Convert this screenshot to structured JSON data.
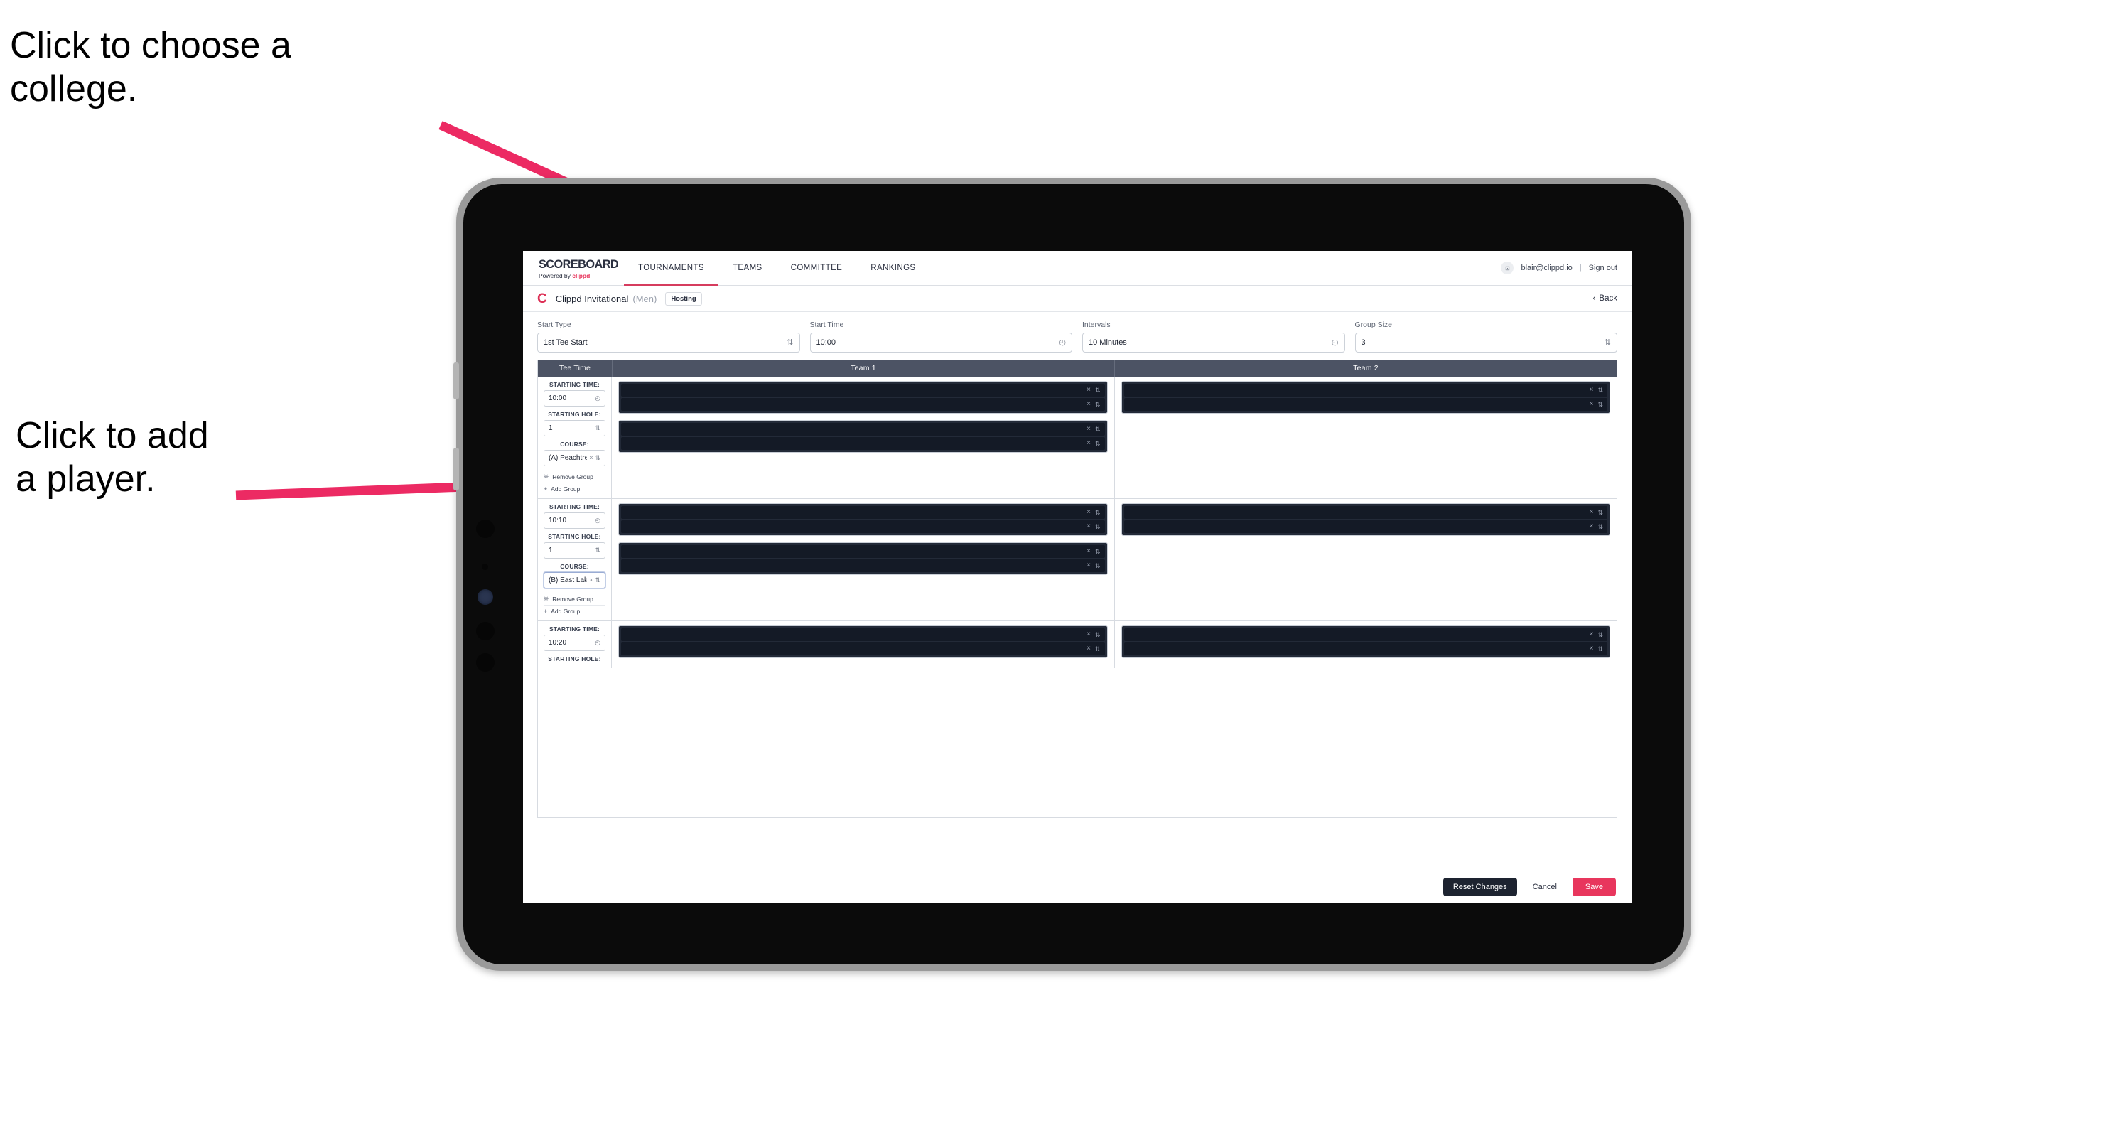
{
  "annotations": [
    {
      "id": "college",
      "text": "Click to choose a\ncollege."
    },
    {
      "id": "player",
      "text": "Click to add\na player."
    }
  ],
  "colors": {
    "accent_pink": "#e8365d",
    "arrow_pink": "#ec2a63",
    "nav_underline": "#d63c5e",
    "table_header": "#4c5364",
    "slot_dark": "#141a26",
    "slot_group": "#232a38",
    "tablet_frame": "#9a9a9a"
  },
  "app": {
    "topnav": {
      "brand_title": "SCOREBOARD",
      "brand_sub_prefix": "Powered by ",
      "brand_sub_accent": "clippd",
      "tabs": [
        {
          "label": "TOURNAMENTS",
          "active": true
        },
        {
          "label": "TEAMS",
          "active": false
        },
        {
          "label": "COMMITTEE",
          "active": false
        },
        {
          "label": "RANKINGS",
          "active": false
        }
      ],
      "avatar_glyph": "⊡",
      "user_email": "blair@clippd.io",
      "separator": "|",
      "sign_out": "Sign out"
    },
    "breadcrumb": {
      "logo": "C",
      "title": "Clippd Invitational",
      "gender": "(Men)",
      "badge": "Hosting",
      "back_chevron": "‹",
      "back_label": "Back"
    },
    "controls": [
      {
        "label": "Start Type",
        "value": "1st Tee Start",
        "icon": "⇅",
        "icon_name": "stepper-icon"
      },
      {
        "label": "Start Time",
        "value": "10:00",
        "icon": "◴",
        "icon_name": "clock-icon"
      },
      {
        "label": "Intervals",
        "value": "10 Minutes",
        "icon": "◴",
        "icon_name": "clock-icon"
      },
      {
        "label": "Group Size",
        "value": "3",
        "icon": "⇅",
        "icon_name": "stepper-icon"
      }
    ],
    "table": {
      "headers": [
        "Tee Time",
        "Team 1",
        "Team 2"
      ],
      "field_labels": {
        "starting_time": "STARTING TIME:",
        "starting_hole": "STARTING HOLE:",
        "course": "COURSE:"
      },
      "actions": {
        "remove_group": "Remove Group",
        "remove_icon": "Ὕ1",
        "add_group": "Add Group",
        "add_icon": "+"
      },
      "slot_icons": {
        "clear": "×",
        "stepper": "⇅"
      },
      "groups": [
        {
          "starting_time": "10:00",
          "starting_hole": "1",
          "course": "(A) Peachtree GC",
          "course_focused": false,
          "team1": [
            {
              "slots": 2
            },
            {
              "slots": 2
            }
          ],
          "team2": [
            {
              "slots": 2
            }
          ]
        },
        {
          "starting_time": "10:10",
          "starting_hole": "1",
          "course": "(B) East Lake GC",
          "course_focused": true,
          "team1": [
            {
              "slots": 2
            },
            {
              "slots": 2
            }
          ],
          "team2": [
            {
              "slots": 2
            }
          ]
        },
        {
          "starting_time": "10:20",
          "starting_hole": "",
          "course": "",
          "course_focused": false,
          "team1": [
            {
              "slots": 2
            }
          ],
          "team2": [
            {
              "slots": 2
            }
          ]
        }
      ]
    },
    "footer": {
      "reset": "Reset Changes",
      "cancel": "Cancel",
      "save": "Save"
    }
  }
}
